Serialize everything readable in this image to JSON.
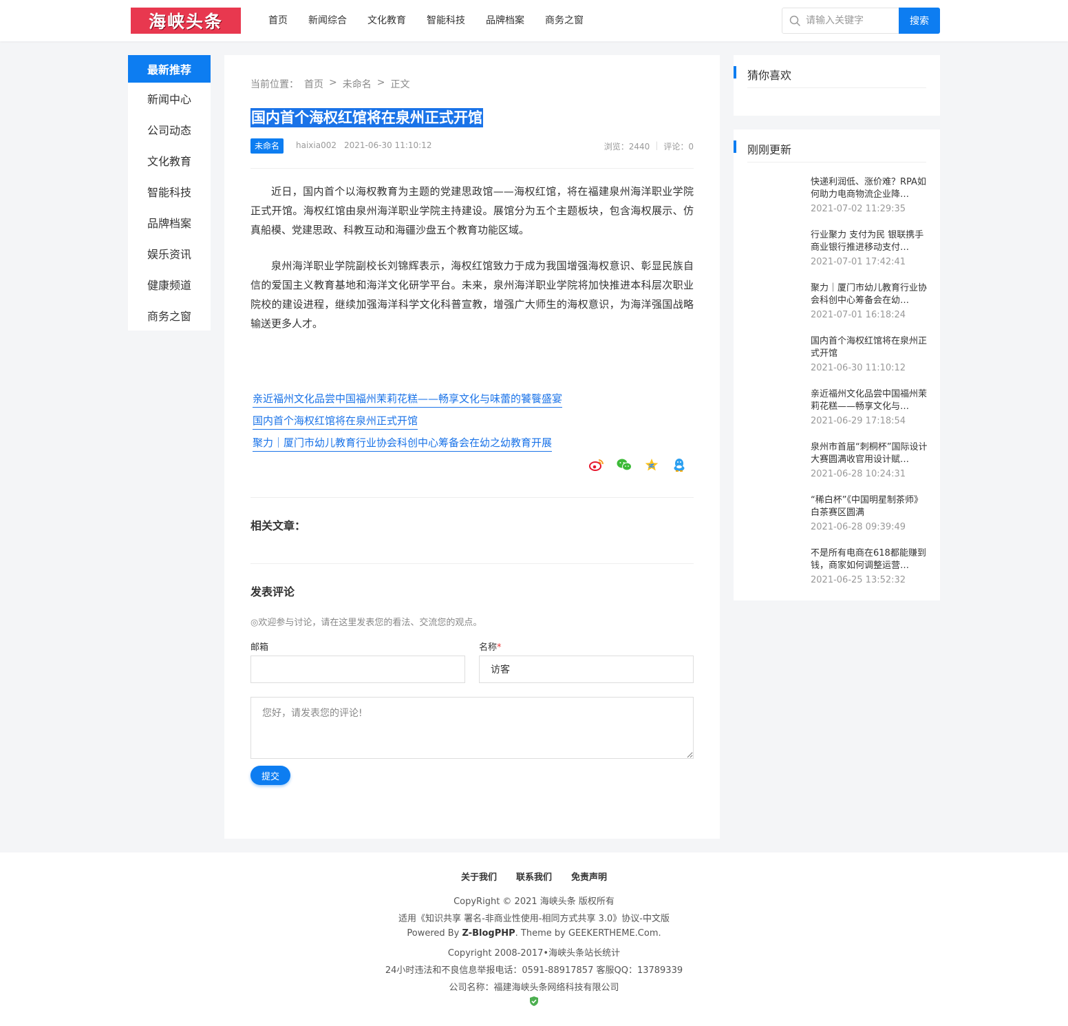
{
  "header": {
    "logo_text": "海峡头条",
    "nav": [
      "首页",
      "新闻综合",
      "文化教育",
      "智能科技",
      "品牌档案",
      "商务之窗"
    ],
    "search_placeholder": "请输入关键字",
    "search_button": "搜索"
  },
  "left_nav": {
    "head": "最新推荐",
    "items": [
      "新闻中心",
      "公司动态",
      "文化教育",
      "智能科技",
      "品牌档案",
      "娱乐资讯",
      "健康频道",
      "商务之窗"
    ]
  },
  "article": {
    "breadcrumb": [
      "当前位置：",
      "首页",
      ">",
      "未命名",
      ">",
      "正文"
    ],
    "title": "国内首个海权红馆将在泉州正式开馆",
    "category": "未命名",
    "author": "haixia002",
    "date": "2021-06-30 11:10:12",
    "views": "浏览：2440",
    "comments": "评论：0",
    "paragraphs": [
      "近日，国内首个以海权教育为主题的党建思政馆——海权红馆，将在福建泉州海洋职业学院正式开馆。海权红馆由泉州海洋职业学院主持建设。展馆分为五个主题板块，包含海权展示、仿真船模、党建思政、科教互动和海疆沙盘五个教育功能区域。",
      "泉州海洋职业学院副校长刘锦辉表示，海权红馆致力于成为我国增强海权意识、彰显民族自信的爱国主义教育基地和海洋文化研学平台。未来，泉州海洋职业学院将加快推进本科层次职业院校的建设进程，继续加强海洋科学文化科普宣教，增强广大师生的海权意识，为海洋强国战略输送更多人才。"
    ],
    "links": [
      "亲近福州文化品尝中国福州茉莉花糕——畅享文化与味蕾的饕餮盛宴",
      "国内首个海权红馆将在泉州正式开馆",
      "聚力｜厦门市幼儿教育行业协会科创中心筹备会在幼之幼教育开展"
    ],
    "share_icons": [
      "weibo-icon",
      "wechat-icon",
      "qzone-icon",
      "qq-icon"
    ],
    "related_title": "相关文章："
  },
  "comment_form": {
    "title": "发表评论",
    "hint": "◎欢迎参与讨论，请在这里发表您的看法、交流您的观点。",
    "email_label": "邮箱",
    "email_value": "",
    "name_label": "名称",
    "name_required": "*",
    "name_value": "访客",
    "textarea_placeholder": "您好，请发表您的评论!",
    "submit": "提交"
  },
  "sidebar": {
    "guess_title": "猜你喜欢",
    "recent_title": "刚刚更新",
    "recent": [
      {
        "title": "快递利润低、涨价难？RPA如何助力电商物流企业降…",
        "date": "2021-07-02 11:29:35"
      },
      {
        "title": "行业聚力 支付为民 银联携手商业银行推进移动支付…",
        "date": "2021-07-01 17:42:41"
      },
      {
        "title": "聚力｜厦门市幼儿教育行业协会科创中心筹备会在幼…",
        "date": "2021-07-01 16:18:24"
      },
      {
        "title": "国内首个海权红馆将在泉州正式开馆",
        "date": "2021-06-30 11:10:12"
      },
      {
        "title": "亲近福州文化品尝中国福州茉莉花糕——畅享文化与…",
        "date": "2021-06-29 17:18:54"
      },
      {
        "title": "泉州市首届“刺桐杯”国际设计大赛圆满收官用设计赋…",
        "date": "2021-06-28 10:24:31"
      },
      {
        "title": "“稀白杯”《中国明星制茶师》白茶赛区圆满",
        "date": "2021-06-28 09:39:49"
      },
      {
        "title": "不是所有电商在618都能赚到钱，商家如何调整运营…",
        "date": "2021-06-25 13:52:32"
      }
    ]
  },
  "footer": {
    "links": [
      "关于我们",
      "联系我们",
      "免责声明"
    ],
    "copyright": "CopyRight © 2021 海峡头条 版权所有",
    "license": "适用《知识共享 署名-非商业性使用-相同方式共享 3.0》协议-中文版",
    "powered_prefix": "Powered By ",
    "powered_brand": "Z-BlogPHP",
    "powered_suffix": ". Theme by GEEKERTHEME.Com.",
    "copyright2": "Copyright 2008-2017•海峡头条站长统计",
    "report": "24小时违法和不良信息举报电话：0591-88917857 客服QQ：13789339",
    "company": "公司名称：福建海峡头条网络科技有限公司"
  },
  "colors": {
    "accent": "#0d7df1",
    "logo_bg": "#e8384f",
    "link": "#1a73e8"
  }
}
